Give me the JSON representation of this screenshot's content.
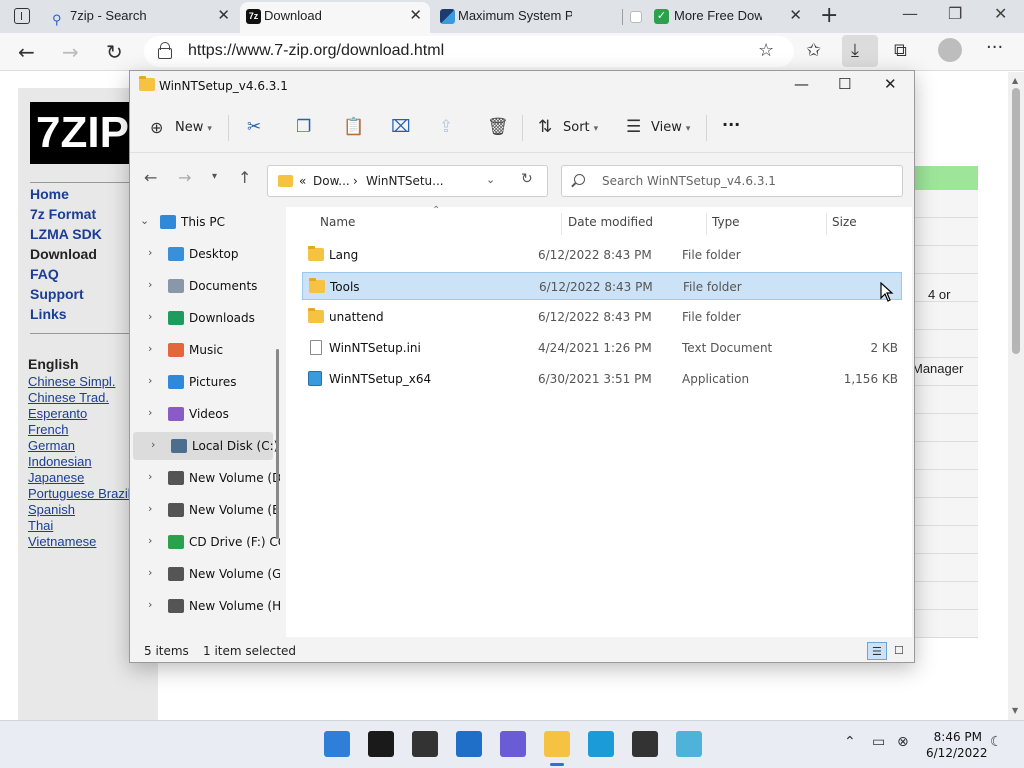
{
  "browser": {
    "tabs": [
      {
        "title": "7zip - Search",
        "active": false,
        "icon": "search-icon"
      },
      {
        "title": "Download",
        "active": true,
        "icon": "7zip-favicon"
      },
      {
        "title": "Maximum System Partition",
        "active": false,
        "icon": "site-favicon"
      },
      {
        "title": "More Free Downloads",
        "active": false,
        "icon": "check-favicon"
      }
    ],
    "new_tab": "+",
    "url": "https://www.7-zip.org/download.html"
  },
  "website": {
    "logo_text": "7ZIP",
    "nav": [
      "Home",
      "7z Format",
      "LZMA SDK",
      "Download",
      "FAQ",
      "Support",
      "Links"
    ],
    "current_nav": "Download",
    "languages_heading": "English",
    "languages": [
      "Chinese Simpl.",
      "Chinese Trad.",
      "Esperanto",
      "French",
      "German",
      "Indonesian",
      "Japanese",
      "Portuguese Brazil",
      "Spanish",
      "Thai",
      "Vietnamese"
    ],
    "fragment_1": "4 or",
    "fragment_2": "Manager"
  },
  "explorer": {
    "title": "WinNTSetup_v4.6.3.1",
    "toolbar": {
      "new_label": "New",
      "sort_label": "Sort",
      "view_label": "View",
      "more_label": "···"
    },
    "path": {
      "overflow": "«",
      "part1": "Dow...",
      "sep": "›",
      "part2": "WinNTSetu..."
    },
    "search_placeholder": "Search WinNTSetup_v4.6.3.1",
    "nav": [
      {
        "label": "This PC",
        "icon": "pc-icon",
        "color": "#2f88d8",
        "expanded": true,
        "selected": false
      },
      {
        "label": "Desktop",
        "icon": "desktop-icon",
        "color": "#3a8fd9",
        "expanded": false,
        "selected": false
      },
      {
        "label": "Documents",
        "icon": "documents-icon",
        "color": "#8a97a8",
        "expanded": false,
        "selected": false
      },
      {
        "label": "Downloads",
        "icon": "downloads-icon",
        "color": "#1f9b5e",
        "expanded": false,
        "selected": false
      },
      {
        "label": "Music",
        "icon": "music-icon",
        "color": "#e2683c",
        "expanded": false,
        "selected": false
      },
      {
        "label": "Pictures",
        "icon": "pictures-icon",
        "color": "#2f88d8",
        "expanded": false,
        "selected": false
      },
      {
        "label": "Videos",
        "icon": "videos-icon",
        "color": "#8a5bc7",
        "expanded": false,
        "selected": false
      },
      {
        "label": "Local Disk (C:)",
        "icon": "drive-icon",
        "color": "#4b6e8f",
        "expanded": false,
        "selected": true
      },
      {
        "label": "New Volume (D:)",
        "icon": "drive-icon",
        "color": "#555555",
        "expanded": false,
        "selected": false
      },
      {
        "label": "New Volume (E:)",
        "icon": "drive-icon",
        "color": "#555555",
        "expanded": false,
        "selected": false
      },
      {
        "label": "CD Drive (F:) CC",
        "icon": "cd-drive-icon",
        "color": "#2aa14a",
        "expanded": false,
        "selected": false
      },
      {
        "label": "New Volume (G:)",
        "icon": "drive-icon",
        "color": "#555555",
        "expanded": false,
        "selected": false
      },
      {
        "label": "New Volume (H:)",
        "icon": "drive-icon",
        "color": "#555555",
        "expanded": false,
        "selected": false
      }
    ],
    "columns": {
      "name": "Name",
      "date": "Date modified",
      "type": "Type",
      "size": "Size"
    },
    "files": [
      {
        "name": "Lang",
        "date": "6/12/2022 8:43 PM",
        "type": "File folder",
        "size": "",
        "icon": "folder-icon",
        "selected": false
      },
      {
        "name": "Tools",
        "date": "6/12/2022 8:43 PM",
        "type": "File folder",
        "size": "",
        "icon": "folder-icon",
        "selected": true
      },
      {
        "name": "unattend",
        "date": "6/12/2022 8:43 PM",
        "type": "File folder",
        "size": "",
        "icon": "folder-icon",
        "selected": false
      },
      {
        "name": "WinNTSetup.ini",
        "date": "4/24/2021 1:26 PM",
        "type": "Text Document",
        "size": "2 KB",
        "icon": "text-file-icon",
        "selected": false
      },
      {
        "name": "WinNTSetup_x64",
        "date": "6/30/2021 3:51 PM",
        "type": "Application",
        "size": "1,156 KB",
        "icon": "app-icon",
        "selected": false
      }
    ],
    "status": {
      "items": "5 items",
      "selected": "1 item selected"
    }
  },
  "taskbar": {
    "apps": [
      {
        "name": "start-icon",
        "color": "#2f7fd8"
      },
      {
        "name": "search-icon",
        "color": "#1a1a1a"
      },
      {
        "name": "task-view-icon",
        "color": "#333333"
      },
      {
        "name": "widgets-icon",
        "color": "#1f6fc9"
      },
      {
        "name": "chat-icon",
        "color": "#6a5bd6"
      },
      {
        "name": "file-explorer-icon",
        "color": "#f5c242"
      },
      {
        "name": "edge-icon",
        "color": "#1b9cd8"
      },
      {
        "name": "store-icon",
        "color": "#333333"
      },
      {
        "name": "tablet-icon",
        "color": "#4fb3d9"
      }
    ],
    "time": "8:46 PM",
    "date": "6/12/2022"
  }
}
